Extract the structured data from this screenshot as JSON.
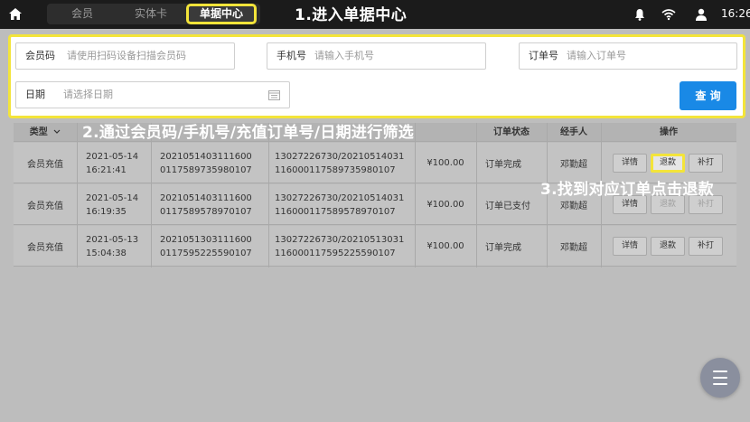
{
  "topbar": {
    "tabs": [
      "会员",
      "实体卡",
      "单据中心"
    ],
    "active_tab": "单据中心",
    "time": "16:26",
    "icons": [
      "home-icon",
      "bell-icon",
      "wifi-icon",
      "user-icon"
    ]
  },
  "annotations": {
    "step1": "1.进入单据中心",
    "step2": "2.通过会员码/手机号/充值订单号/日期进行筛选",
    "step3": "3.找到对应订单点击退款"
  },
  "filter": {
    "member_code_label": "会员码",
    "member_code_placeholder": "请使用扫码设备扫描会员码",
    "phone_label": "手机号",
    "phone_placeholder": "请输入手机号",
    "order_label": "订单号",
    "order_placeholder": "请输入订单号",
    "date_label": "日期",
    "date_placeholder": "请选择日期",
    "query_button": "查 询"
  },
  "table": {
    "headers": {
      "type": "类型",
      "status": "订单状态",
      "handler": "经手人",
      "actions": "操作"
    },
    "rows": [
      {
        "type": "会员充值",
        "date": "2021-05-14",
        "time": "16:21:41",
        "order_no_1": "2021051403111600",
        "order_no_2": "0117589735980107",
        "detail_1": "13027226730/20210514031",
        "detail_2": "116000117589735980107",
        "amount": "¥100.00",
        "status": "订单完成",
        "handler": "邓勤超",
        "btn_detail": "详情",
        "btn_refund": "退款",
        "btn_reprint": "补打"
      },
      {
        "type": "会员充值",
        "date": "2021-05-14",
        "time": "16:19:35",
        "order_no_1": "2021051403111600",
        "order_no_2": "0117589578970107",
        "detail_1": "13027226730/20210514031",
        "detail_2": "116000117589578970107",
        "amount": "¥100.00",
        "status": "订单已支付",
        "handler": "邓勤超",
        "btn_detail": "详情",
        "btn_refund": "退款",
        "btn_reprint": "补打"
      },
      {
        "type": "会员充值",
        "date": "2021-05-13",
        "time": "15:04:38",
        "order_no_1": "2021051303111600",
        "order_no_2": "0117595225590107",
        "detail_1": "13027226730/20210513031",
        "detail_2": "116000117595225590107",
        "amount": "¥100.00",
        "status": "订单完成",
        "handler": "邓勤超",
        "btn_detail": "详情",
        "btn_refund": "退款",
        "btn_reprint": "补打"
      }
    ]
  },
  "colors": {
    "highlight": "#f3e43a",
    "primary": "#1989e6",
    "topbar": "#1b1b1b",
    "overlay_bg": "#bdbdbd"
  }
}
